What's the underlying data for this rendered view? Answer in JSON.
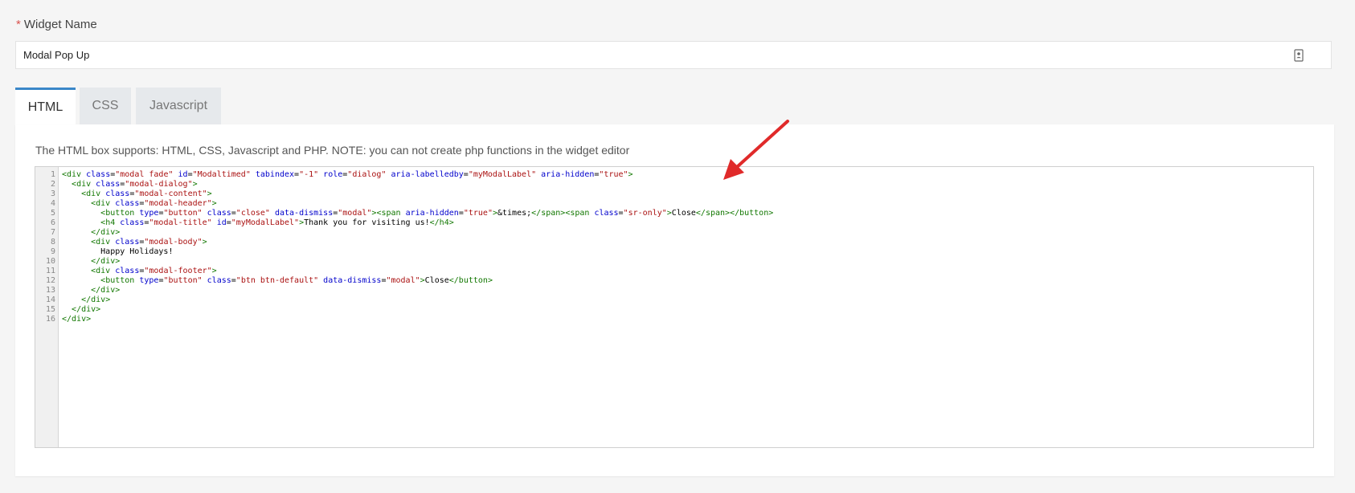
{
  "form": {
    "required_mark": "*",
    "widget_name_label": "Widget Name",
    "widget_name_value": "Modal Pop Up"
  },
  "tabs": [
    {
      "label": "HTML",
      "active": true
    },
    {
      "label": "CSS",
      "active": false
    },
    {
      "label": "Javascript",
      "active": false
    }
  ],
  "panel": {
    "note": "The HTML box supports: HTML, CSS, Javascript and PHP. NOTE: you can not create php functions in the widget editor"
  },
  "editor": {
    "line_numbers": [
      "1",
      "2",
      "3",
      "4",
      "5",
      "6",
      "7",
      "8",
      "9",
      "10",
      "11",
      "12",
      "13",
      "14",
      "15",
      "16"
    ],
    "lines": [
      "<div class=\"modal fade\" id=\"Modaltimed\" tabindex=\"-1\" role=\"dialog\" aria-labelledby=\"myModalLabel\" aria-hidden=\"true\">",
      "  <div class=\"modal-dialog\">",
      "    <div class=\"modal-content\">",
      "      <div class=\"modal-header\">",
      "        <button type=\"button\" class=\"close\" data-dismiss=\"modal\"><span aria-hidden=\"true\">&times;</span><span class=\"sr-only\">Close</span></button>",
      "        <h4 class=\"modal-title\" id=\"myModalLabel\">Thank you for visiting us!</h4>",
      "      </div>",
      "      <div class=\"modal-body\">",
      "        Happy Holidays!",
      "      </div>",
      "      <div class=\"modal-footer\">",
      "        <button type=\"button\" class=\"btn btn-default\" data-dismiss=\"modal\">Close</button>",
      "      </div>",
      "    </div>",
      "  </div>",
      "</div>"
    ]
  },
  "colors": {
    "accent_tab": "#3a87c8",
    "required": "#d9534f",
    "arrow": "#e02a2a",
    "code_tag": "#117700",
    "code_attr": "#0000cc",
    "code_string": "#aa1111"
  },
  "icons": {
    "name_field_icon": "contact-card-icon",
    "annotation": "red-arrow-icon"
  }
}
